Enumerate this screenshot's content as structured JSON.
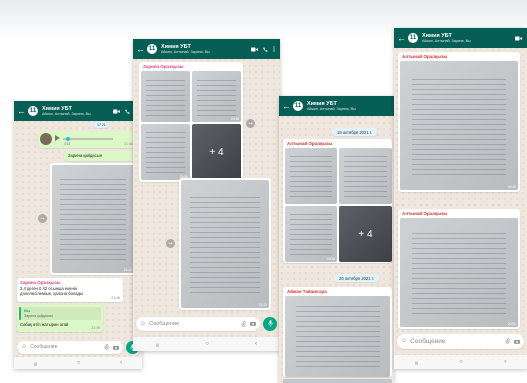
{
  "chat": {
    "title": "Химия УБТ",
    "subtitle": "Айжан, Алтынай, Зарина, Вы",
    "unread": "11"
  },
  "phone1": {
    "date_chip": "17 21",
    "audio_time": "0:15",
    "audio_sent": "21:40",
    "caption": "Зарина қайдасын",
    "photo_time": "21:42",
    "quoted_sender": "Зарина Оразқызы",
    "quoted_text": "3.4 деген 0.42 осынша екенін дәлелесілеміын, қалона болады",
    "quoted_time": "21:48",
    "reply_sender": "Вы",
    "reply_preview": "Зарина қайдасын",
    "reply_text": "Сабақ өтіп жатыран ағай",
    "reply_time": "21:49"
  },
  "phone2": {
    "sender": "Зарина Оразқызы",
    "time_grid": "09:38",
    "more_count": "+ 4",
    "photo_time": "21:23"
  },
  "phone3": {
    "date1": "18 октября 2021 г.",
    "date2": "20 октября 2021 г.",
    "sender1": "Алтынай Оралқызы",
    "more_count": "+ 4",
    "grid_time": "09:38",
    "sender2": "Айжан Тайшигара"
  },
  "phone4": {
    "sender1": "Алтынай Оралқызы",
    "sender2": "Алтынай Оралқызы",
    "photo_time1": "20:48",
    "photo_time2": "20:52"
  },
  "composer": {
    "placeholder": "Сообщение"
  },
  "icons": {
    "back": "←",
    "emoji": "☺",
    "attach": "📎",
    "camera": "◉",
    "mic": "🎤",
    "nav_menu": "|||",
    "nav_home": "○",
    "nav_back": "‹",
    "share": "↪"
  },
  "colors": {
    "header": "#075e54",
    "mic": "#00a884",
    "outgoing": "#dcf8c6",
    "date_chip": "#e1f2fb"
  }
}
